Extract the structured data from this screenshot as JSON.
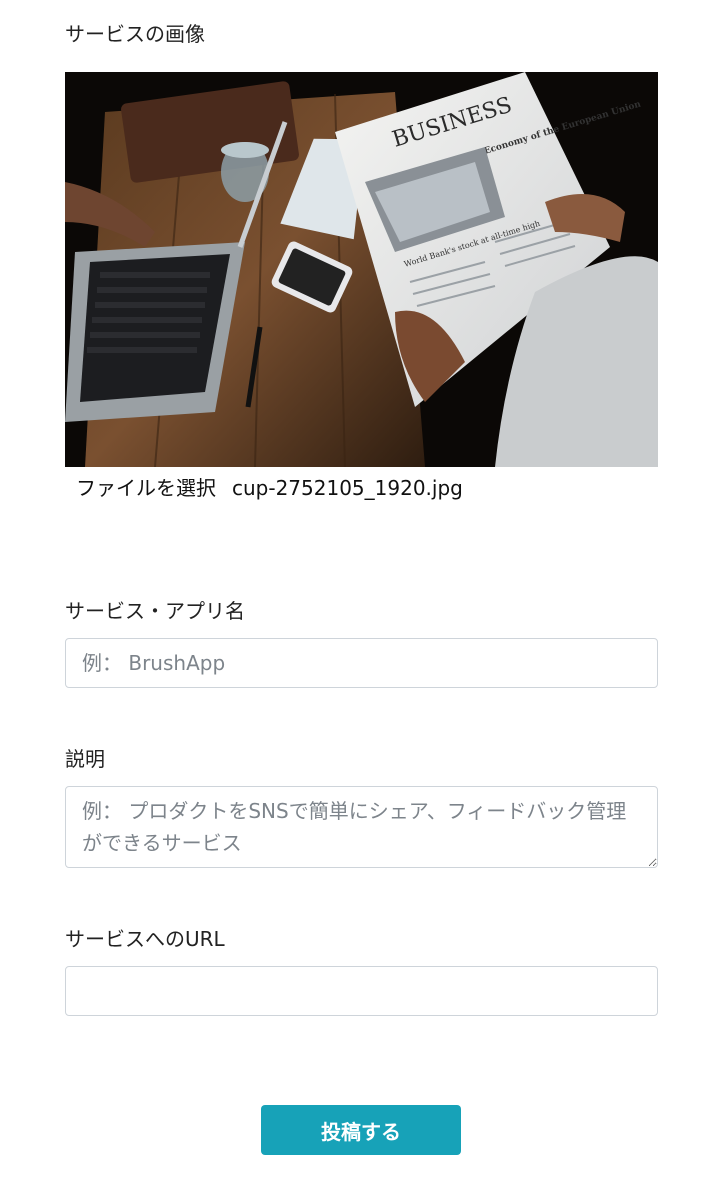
{
  "image_section": {
    "label": "サービスの画像",
    "photo_icon": "photo-of-newspaper-laptop-desk",
    "newspaper_masthead": "BUSINESS",
    "newspaper_headline": "Economy of the European Union",
    "newspaper_subhead": "World Bank's stock at all-time high",
    "file_button_label": "ファイルを選択",
    "file_name": "cup-2752105_1920.jpg"
  },
  "name_field": {
    "label": "サービス・アプリ名",
    "placeholder": "例： BrushApp",
    "value": ""
  },
  "description_field": {
    "label": "説明",
    "placeholder": "例： プロダクトをSNSで簡単にシェア、フィードバック管理ができるサービス",
    "value": ""
  },
  "url_field": {
    "label": "サービスへのURL",
    "placeholder": "",
    "value": ""
  },
  "submit": {
    "label": "投稿する",
    "color": "#17a2b8"
  }
}
